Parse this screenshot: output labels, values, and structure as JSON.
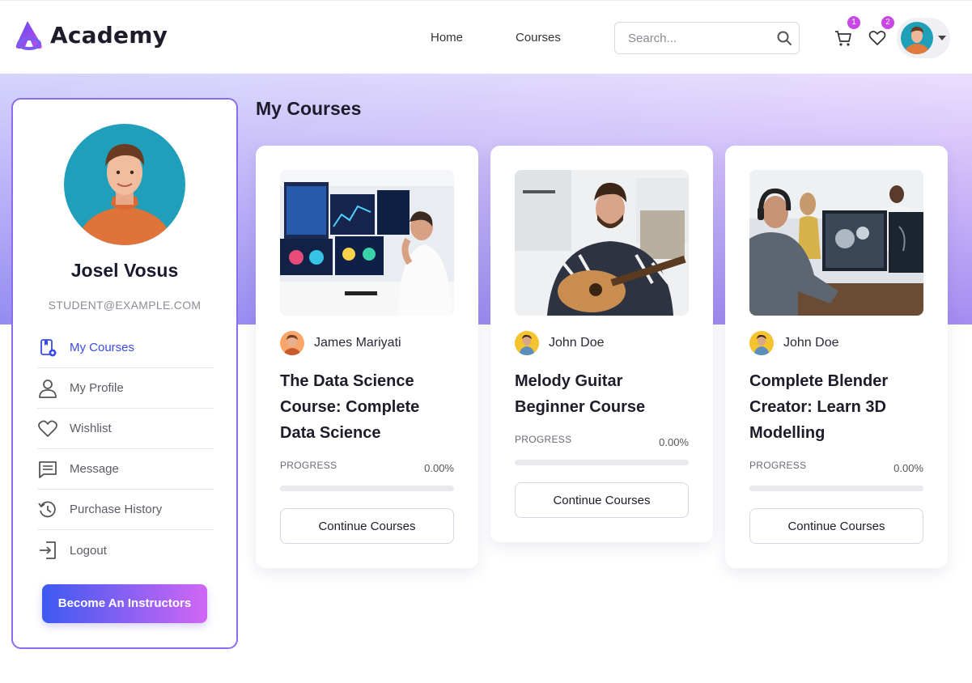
{
  "header": {
    "brand": "Academy",
    "nav": [
      {
        "label": "Home"
      },
      {
        "label": "Courses"
      }
    ],
    "search": {
      "placeholder": "Search...",
      "value": ""
    },
    "cart_count": "1",
    "wishlist_count": "2"
  },
  "sidebar": {
    "user_name": "Josel Vosus",
    "user_email": "STUDENT@EXAMPLE.COM",
    "menu": [
      {
        "label": "My Courses",
        "icon": "courses-icon",
        "active": true
      },
      {
        "label": "My Profile",
        "icon": "user-icon",
        "active": false
      },
      {
        "label": "Wishlist",
        "icon": "heart-icon",
        "active": false
      },
      {
        "label": "Message",
        "icon": "message-icon",
        "active": false
      },
      {
        "label": "Purchase History",
        "icon": "history-icon",
        "active": false
      },
      {
        "label": "Logout",
        "icon": "logout-icon",
        "active": false
      }
    ],
    "become_label": "Become An Instructors"
  },
  "main": {
    "title": "My Courses",
    "courses": [
      {
        "author": "James Mariyati",
        "title": "The Data Science Course: Complete Data Science",
        "progress_label": "PROGRESS",
        "progress_text": "0.00%",
        "progress": 0,
        "button": "Continue Courses"
      },
      {
        "author": "John Doe",
        "title": "Melody Guitar Beginner Course",
        "progress_label": "PROGRESS",
        "progress_text": "0.00%",
        "progress": 0,
        "button": "Continue Courses"
      },
      {
        "author": "John Doe",
        "title": "Complete Blender Creator: Learn 3D Modelling",
        "progress_label": "PROGRESS",
        "progress_text": "0.00%",
        "progress": 0,
        "button": "Continue Courses"
      }
    ]
  },
  "colors": {
    "accent": "#3b4de8",
    "badge": "#c845e6",
    "gradient_start": "#3d5af1",
    "gradient_end": "#d166f5"
  }
}
